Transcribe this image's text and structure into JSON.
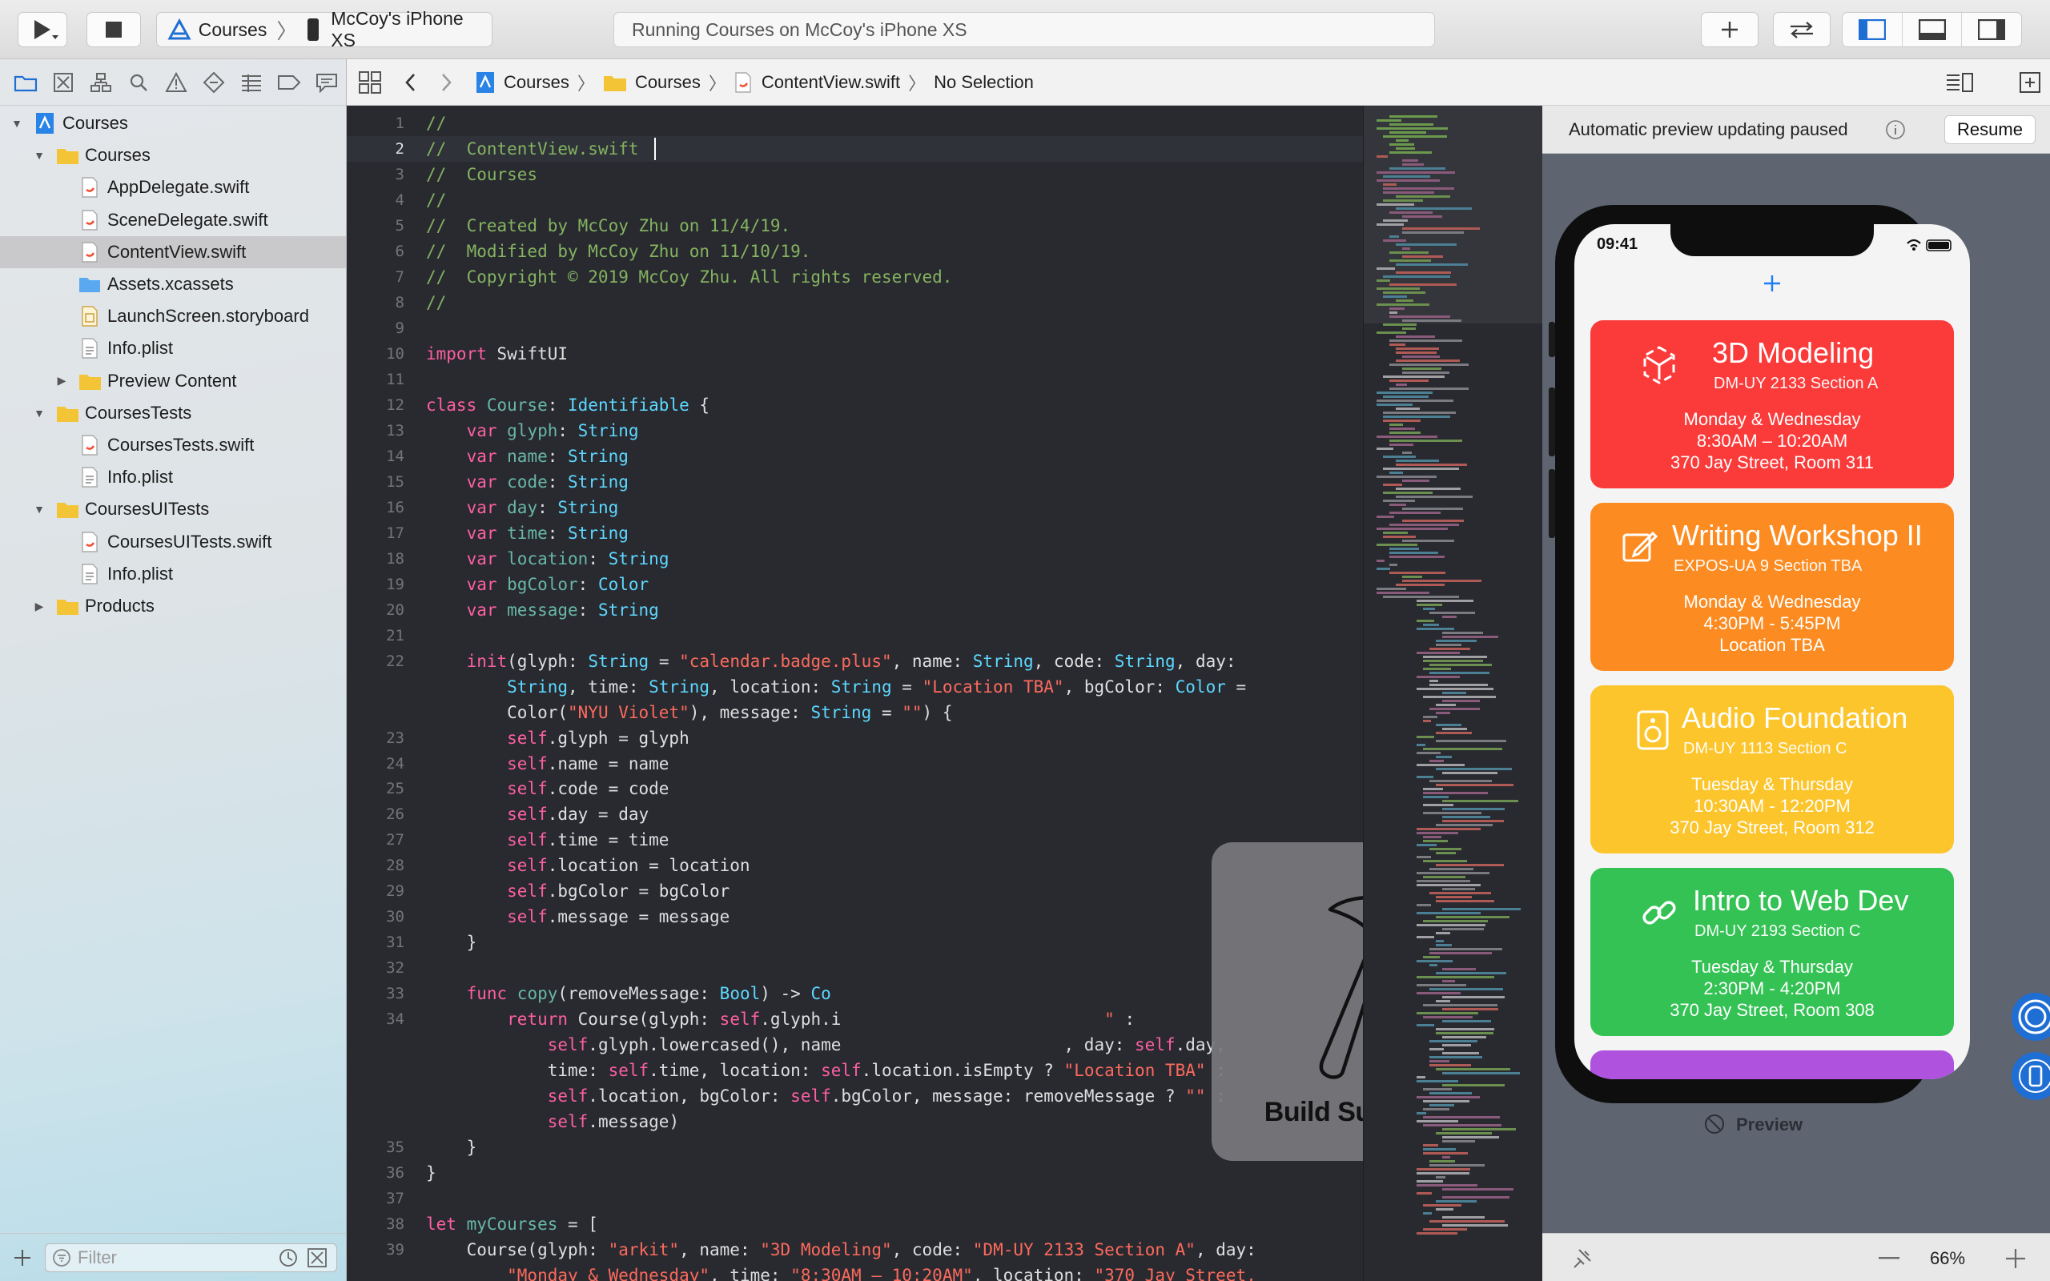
{
  "toolbar": {
    "scheme_target": "Courses",
    "scheme_device": "McCoy's iPhone XS",
    "activity_status": "Running Courses on McCoy's iPhone XS"
  },
  "navigator": {
    "items": [
      {
        "label": "Courses",
        "kind": "project",
        "indent": 0,
        "disclosure": "open"
      },
      {
        "label": "Courses",
        "kind": "folder",
        "indent": 1,
        "disclosure": "open"
      },
      {
        "label": "AppDelegate.swift",
        "kind": "swift",
        "indent": 2
      },
      {
        "label": "SceneDelegate.swift",
        "kind": "swift",
        "indent": 2
      },
      {
        "label": "ContentView.swift",
        "kind": "swift",
        "indent": 2,
        "selected": true
      },
      {
        "label": "Assets.xcassets",
        "kind": "assets",
        "indent": 2
      },
      {
        "label": "LaunchScreen.storyboard",
        "kind": "storyboard",
        "indent": 2
      },
      {
        "label": "Info.plist",
        "kind": "plist",
        "indent": 2
      },
      {
        "label": "Preview Content",
        "kind": "folder",
        "indent": 2,
        "disclosure": "closed"
      },
      {
        "label": "CoursesTests",
        "kind": "folder",
        "indent": 1,
        "disclosure": "open"
      },
      {
        "label": "CoursesTests.swift",
        "kind": "swift",
        "indent": 2
      },
      {
        "label": "Info.plist",
        "kind": "plist",
        "indent": 2
      },
      {
        "label": "CoursesUITests",
        "kind": "folder",
        "indent": 1,
        "disclosure": "open"
      },
      {
        "label": "CoursesUITests.swift",
        "kind": "swift",
        "indent": 2
      },
      {
        "label": "Info.plist",
        "kind": "plist",
        "indent": 2
      },
      {
        "label": "Products",
        "kind": "folder",
        "indent": 1,
        "disclosure": "closed"
      }
    ],
    "filter_placeholder": "Filter"
  },
  "jumpbar": {
    "crumbs": [
      "Courses",
      "Courses",
      "ContentView.swift",
      "No Selection"
    ]
  },
  "editor": {
    "current_line": 2,
    "lines": [
      {
        "n": "1",
        "tokens": [
          [
            "cg",
            "//"
          ]
        ]
      },
      {
        "n": "2",
        "tokens": [
          [
            "cg",
            "//  ContentView.swift"
          ]
        ]
      },
      {
        "n": "3",
        "tokens": [
          [
            "cg",
            "//  Courses"
          ]
        ]
      },
      {
        "n": "4",
        "tokens": [
          [
            "cg",
            "//"
          ]
        ]
      },
      {
        "n": "5",
        "tokens": [
          [
            "cg",
            "//  Created by McCoy Zhu on 11/4/19."
          ]
        ]
      },
      {
        "n": "6",
        "tokens": [
          [
            "cg",
            "//  Modified by McCoy Zhu on 11/10/19."
          ]
        ]
      },
      {
        "n": "7",
        "tokens": [
          [
            "cg",
            "//  Copyright © 2019 McCoy Zhu. All rights reserved."
          ]
        ]
      },
      {
        "n": "8",
        "tokens": [
          [
            "cg",
            "//"
          ]
        ]
      },
      {
        "n": "9",
        "tokens": []
      },
      {
        "n": "10",
        "tokens": [
          [
            "kw",
            "import "
          ],
          [
            "pl",
            "SwiftUI"
          ]
        ]
      },
      {
        "n": "11",
        "tokens": []
      },
      {
        "n": "12",
        "tokens": [
          [
            "kw",
            "class "
          ],
          [
            "fn",
            "Course"
          ],
          [
            "pl",
            ": "
          ],
          [
            "ty",
            "Identifiable"
          ],
          [
            "pl",
            " {"
          ]
        ]
      },
      {
        "n": "13",
        "tokens": [
          [
            "kw",
            "    var "
          ],
          [
            "fn",
            "glyph"
          ],
          [
            "pl",
            ": "
          ],
          [
            "ty",
            "String"
          ]
        ]
      },
      {
        "n": "14",
        "tokens": [
          [
            "kw",
            "    var "
          ],
          [
            "fn",
            "name"
          ],
          [
            "pl",
            ": "
          ],
          [
            "ty",
            "String"
          ]
        ]
      },
      {
        "n": "15",
        "tokens": [
          [
            "kw",
            "    var "
          ],
          [
            "fn",
            "code"
          ],
          [
            "pl",
            ": "
          ],
          [
            "ty",
            "String"
          ]
        ]
      },
      {
        "n": "16",
        "tokens": [
          [
            "kw",
            "    var "
          ],
          [
            "fn",
            "day"
          ],
          [
            "pl",
            ": "
          ],
          [
            "ty",
            "String"
          ]
        ]
      },
      {
        "n": "17",
        "tokens": [
          [
            "kw",
            "    var "
          ],
          [
            "fn",
            "time"
          ],
          [
            "pl",
            ": "
          ],
          [
            "ty",
            "String"
          ]
        ]
      },
      {
        "n": "18",
        "tokens": [
          [
            "kw",
            "    var "
          ],
          [
            "fn",
            "location"
          ],
          [
            "pl",
            ": "
          ],
          [
            "ty",
            "String"
          ]
        ]
      },
      {
        "n": "19",
        "tokens": [
          [
            "kw",
            "    var "
          ],
          [
            "fn",
            "bgColor"
          ],
          [
            "pl",
            ": "
          ],
          [
            "ty",
            "Color"
          ]
        ]
      },
      {
        "n": "20",
        "tokens": [
          [
            "kw",
            "    var "
          ],
          [
            "fn",
            "message"
          ],
          [
            "pl",
            ": "
          ],
          [
            "ty",
            "String"
          ]
        ]
      },
      {
        "n": "21",
        "tokens": []
      },
      {
        "n": "22",
        "tokens": [
          [
            "kw",
            "    init"
          ],
          [
            "pl",
            "(glyph: "
          ],
          [
            "ty",
            "String"
          ],
          [
            "pl",
            " = "
          ],
          [
            "st",
            "\"calendar.badge.plus\""
          ],
          [
            "pl",
            ", name: "
          ],
          [
            "ty",
            "String"
          ],
          [
            "pl",
            ", code: "
          ],
          [
            "ty",
            "String"
          ],
          [
            "pl",
            ", day:"
          ]
        ]
      },
      {
        "n": "",
        "tokens": [
          [
            "ty",
            "        String"
          ],
          [
            "pl",
            ", time: "
          ],
          [
            "ty",
            "String"
          ],
          [
            "pl",
            ", location: "
          ],
          [
            "ty",
            "String"
          ],
          [
            "pl",
            " = "
          ],
          [
            "st",
            "\"Location TBA\""
          ],
          [
            "pl",
            ", bgColor: "
          ],
          [
            "ty",
            "Color"
          ],
          [
            "pl",
            " ="
          ]
        ]
      },
      {
        "n": "",
        "tokens": [
          [
            "pl",
            "        Color("
          ],
          [
            "st",
            "\"NYU Violet\""
          ],
          [
            "pl",
            "), message: "
          ],
          [
            "ty",
            "String"
          ],
          [
            "pl",
            " = "
          ],
          [
            "st",
            "\"\""
          ],
          [
            "pl",
            ") {"
          ]
        ]
      },
      {
        "n": "23",
        "tokens": [
          [
            "kw",
            "        self"
          ],
          [
            "pl",
            ".glyph = glyph"
          ]
        ]
      },
      {
        "n": "24",
        "tokens": [
          [
            "kw",
            "        self"
          ],
          [
            "pl",
            ".name = name"
          ]
        ]
      },
      {
        "n": "25",
        "tokens": [
          [
            "kw",
            "        self"
          ],
          [
            "pl",
            ".code = code"
          ]
        ]
      },
      {
        "n": "26",
        "tokens": [
          [
            "kw",
            "        self"
          ],
          [
            "pl",
            ".day = day"
          ]
        ]
      },
      {
        "n": "27",
        "tokens": [
          [
            "kw",
            "        self"
          ],
          [
            "pl",
            ".time = time"
          ]
        ]
      },
      {
        "n": "28",
        "tokens": [
          [
            "kw",
            "        self"
          ],
          [
            "pl",
            ".location = location"
          ]
        ]
      },
      {
        "n": "29",
        "tokens": [
          [
            "kw",
            "        self"
          ],
          [
            "pl",
            ".bgColor = bgColor"
          ]
        ]
      },
      {
        "n": "30",
        "tokens": [
          [
            "kw",
            "        self"
          ],
          [
            "pl",
            ".message = message"
          ]
        ]
      },
      {
        "n": "31",
        "tokens": [
          [
            "pl",
            "    }"
          ]
        ]
      },
      {
        "n": "32",
        "tokens": []
      },
      {
        "n": "33",
        "tokens": [
          [
            "kw",
            "    func "
          ],
          [
            "fn",
            "copy"
          ],
          [
            "pl",
            "(removeMessage: "
          ],
          [
            "ty",
            "Bool"
          ],
          [
            "pl",
            ") -> "
          ],
          [
            "ty",
            "Co"
          ]
        ]
      },
      {
        "n": "34",
        "tokens": [
          [
            "kw",
            "        return "
          ],
          [
            "pl",
            "Course(glyph: "
          ],
          [
            "kw",
            "self"
          ],
          [
            "pl",
            ".glyph.i"
          ],
          [
            "pl",
            "                          "
          ],
          [
            "st",
            "\""
          ],
          [
            "pl",
            " :"
          ]
        ]
      },
      {
        "n": "",
        "tokens": [
          [
            "kw",
            "            self"
          ],
          [
            "pl",
            ".glyph.lowercased(), name"
          ],
          [
            "pl",
            "                      , day: "
          ],
          [
            "kw",
            "self"
          ],
          [
            "pl",
            ".day,"
          ]
        ]
      },
      {
        "n": "",
        "tokens": [
          [
            "pl",
            "            time: "
          ],
          [
            "kw",
            "self"
          ],
          [
            "pl",
            ".time, location: "
          ],
          [
            "kw",
            "self"
          ],
          [
            "pl",
            ".location.isEmpty ? "
          ],
          [
            "st",
            "\"Location TBA\""
          ],
          [
            "pl",
            " :"
          ]
        ]
      },
      {
        "n": "",
        "tokens": [
          [
            "kw",
            "            self"
          ],
          [
            "pl",
            ".location, bgColor: "
          ],
          [
            "kw",
            "self"
          ],
          [
            "pl",
            ".bgColor, message: removeMessage ? "
          ],
          [
            "st",
            "\"\""
          ],
          [
            "pl",
            " :"
          ]
        ]
      },
      {
        "n": "",
        "tokens": [
          [
            "kw",
            "            self"
          ],
          [
            "pl",
            ".message)"
          ]
        ]
      },
      {
        "n": "35",
        "tokens": [
          [
            "pl",
            "    }"
          ]
        ]
      },
      {
        "n": "36",
        "tokens": [
          [
            "pl",
            "}"
          ]
        ]
      },
      {
        "n": "37",
        "tokens": []
      },
      {
        "n": "38",
        "tokens": [
          [
            "kw",
            "let "
          ],
          [
            "fn",
            "myCourses"
          ],
          [
            "pl",
            " = ["
          ]
        ]
      },
      {
        "n": "39",
        "tokens": [
          [
            "pl",
            "    Course(glyph: "
          ],
          [
            "st",
            "\"arkit\""
          ],
          [
            "pl",
            ", name: "
          ],
          [
            "st",
            "\"3D Modeling\""
          ],
          [
            "pl",
            ", code: "
          ],
          [
            "st",
            "\"DM-UY 2133 Section A\""
          ],
          [
            "pl",
            ", day:"
          ]
        ]
      },
      {
        "n": "",
        "tokens": [
          [
            "st",
            "        \"Monday & Wednesday\""
          ],
          [
            "pl",
            ", time: "
          ],
          [
            "st",
            "\"8:30AM – 10:20AM\""
          ],
          [
            "pl",
            ", location: "
          ],
          [
            "st",
            "\"370 Jay Street,"
          ]
        ]
      }
    ]
  },
  "hud": {
    "label": "Build Succeeded"
  },
  "canvas": {
    "status_text": "Automatic preview updating paused",
    "resume_label": "Resume",
    "preview_label": "Preview",
    "zoom": "66%"
  },
  "phone": {
    "time": "09:41",
    "add_symbol": "+",
    "cards": [
      {
        "title": "3D Modeling",
        "code": "DM-UY 2133 Section A",
        "day": "Monday & Wednesday",
        "time": "8:30AM – 10:20AM",
        "location": "370 Jay Street, Room 311",
        "color": "#fb3a3a",
        "icon": "arkit-icon"
      },
      {
        "title": "Writing Workshop II",
        "code": "EXPOS-UA 9 Section TBA",
        "day": "Monday & Wednesday",
        "time": "4:30PM - 5:45PM",
        "location": "Location TBA",
        "color": "#fc8c22",
        "icon": "compose-icon"
      },
      {
        "title": "Audio Foundation",
        "code": "DM-UY 1113 Section C",
        "day": "Tuesday & Thursday",
        "time": "10:30AM - 12:20PM",
        "location": "370 Jay Street, Room 312",
        "color": "#fcc52c",
        "icon": "speaker-icon"
      },
      {
        "title": "Intro to Web Dev",
        "code": "DM-UY 2193 Section C",
        "day": "Tuesday & Thursday",
        "time": "2:30PM - 4:20PM",
        "location": "370 Jay Street, Room 308",
        "color": "#34c254",
        "icon": "link-icon"
      }
    ],
    "partial_card_color": "#af52de"
  }
}
